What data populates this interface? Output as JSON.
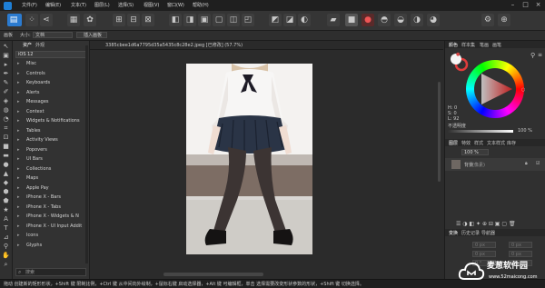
{
  "menubar": {
    "items": [
      "文件(F)",
      "编辑(E)",
      "文本(T)",
      "图层(L)",
      "选择(S)",
      "视图(V)",
      "窗口(W)",
      "帮助(H)"
    ]
  },
  "context": {
    "label1": "画板",
    "label2": "大小:",
    "size_value": "文档",
    "insert_button": "插入画板"
  },
  "assets": {
    "tabs": [
      "资产",
      "外观"
    ],
    "library": "iOS 12",
    "items": [
      "Misc",
      "Controls",
      "Keyboards",
      "Alerts",
      "Messages",
      "Context",
      "Widgets & Notifications",
      "Tables",
      "Activity Views",
      "Popovers",
      "UI Bars",
      "Collections",
      "Maps",
      "Apple Pay",
      "iPhone X - Bars",
      "iPhone X - Tabs",
      "iPhone X - Widgets & N",
      "iPhone X - UI Input Addit",
      "Icons",
      "Glyphs"
    ],
    "search_placeholder": "搜索"
  },
  "document": {
    "tab_title": "3385cbee1d6a7795d35a5435c8c28e2.jpeg [已修改] (57.7%)"
  },
  "right_panel": {
    "top_tabs": [
      "颜色",
      "样本集",
      "笔画",
      "画笔"
    ],
    "hsl": {
      "h": "H: 0",
      "s": "S: 0",
      "l": "L: 92"
    },
    "opacity_label": "不透明度",
    "opacity_value": "100 %",
    "layer_tabs": [
      "图层",
      "特效",
      "样式",
      "文本样式",
      "库存"
    ],
    "layer_opacity": "100 %",
    "layer_name": "背景",
    "layer_sub": "(像素)",
    "bottom_tabs": [
      "变换",
      "历史记录",
      "导航器"
    ],
    "transform": {
      "x": "0 px",
      "y": "0 px",
      "w": "0 px",
      "h": "0 px",
      "r": "0 °",
      "s": "0 °"
    }
  },
  "status": {
    "text": "拖动 创建新的矩形形状，+Shift 键 限制比例，+Ctrl 键 从中间向外绘制，+鼠标右键 启动选择器，+Alt 键 可编辑框，单击 选择需要改变形状参数的形状，+Shift 键 切换选择。"
  },
  "watermark": {
    "title": "麦葱软件园",
    "url": "www.52maicong.com"
  },
  "colors": {
    "accent": "#2b7bd0",
    "panel": "#303030",
    "menubar": "#1f1f1f"
  }
}
